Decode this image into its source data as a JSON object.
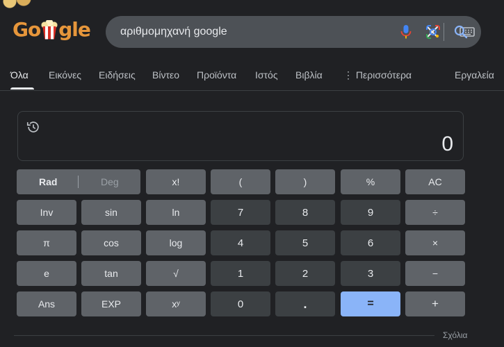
{
  "logo": {
    "text_left": "Go",
    "text_right": "gle"
  },
  "search": {
    "query": "αριθμομηχανή google"
  },
  "tabs": [
    {
      "label": "Όλα"
    },
    {
      "label": "Εικόνες"
    },
    {
      "label": "Ειδήσεις"
    },
    {
      "label": "Βίντεο"
    },
    {
      "label": "Προϊόντα"
    },
    {
      "label": "Ιστός"
    },
    {
      "label": "Βιβλία"
    },
    {
      "label": "⋮ Περισσότερα"
    },
    {
      "label": "Εργαλεία"
    }
  ],
  "calculator": {
    "result": "0",
    "mode_rad": "Rad",
    "mode_deg": "Deg",
    "keys": {
      "factorial": "x!",
      "lparen": "(",
      "rparen": ")",
      "percent": "%",
      "ac": "AC",
      "inv": "Inv",
      "sin": "sin",
      "ln": "ln",
      "seven": "7",
      "eight": "8",
      "nine": "9",
      "divide": "÷",
      "pi": "π",
      "cos": "cos",
      "log": "log",
      "four": "4",
      "five": "5",
      "six": "6",
      "multiply": "×",
      "e": "e",
      "tan": "tan",
      "sqrt": "√",
      "one": "1",
      "two": "2",
      "three": "3",
      "minus": "−",
      "ans": "Ans",
      "exp": "EXP",
      "power": "xʸ",
      "zero": "0",
      "dot": ".",
      "equals": "=",
      "plus": "+"
    }
  },
  "footer": {
    "feedback": "Σχόλια"
  },
  "colors": {
    "accent": "#8ab4f8",
    "background": "#202124",
    "fn_key": "#5f6368",
    "num_key": "#3c4043"
  }
}
